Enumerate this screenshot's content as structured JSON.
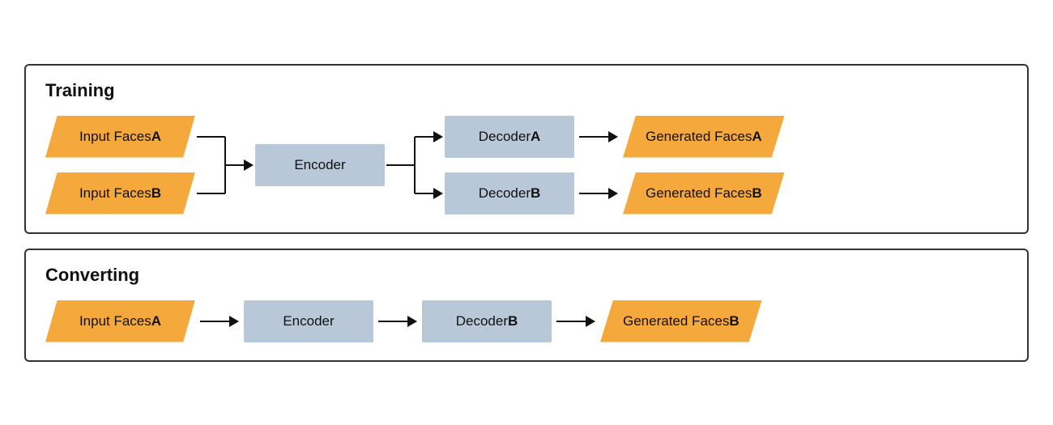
{
  "training": {
    "title": "Training",
    "input_a": {
      "text": "Input Faces ",
      "bold": "A"
    },
    "input_b": {
      "text": "Input Faces ",
      "bold": "B"
    },
    "encoder": {
      "text": "Encoder"
    },
    "decoder_a": {
      "text": "Decoder ",
      "bold": "A"
    },
    "decoder_b": {
      "text": "Decoder ",
      "bold": "B"
    },
    "generated_a": {
      "text": "Generated Faces ",
      "bold": "A"
    },
    "generated_b": {
      "text": "Generated Faces ",
      "bold": "B"
    }
  },
  "converting": {
    "title": "Converting",
    "input_a": {
      "text": "Input Faces ",
      "bold": "A"
    },
    "encoder": {
      "text": "Encoder"
    },
    "decoder_b": {
      "text": "Decoder ",
      "bold": "B"
    },
    "generated_b": {
      "text": "Generated Faces ",
      "bold": "B"
    }
  }
}
